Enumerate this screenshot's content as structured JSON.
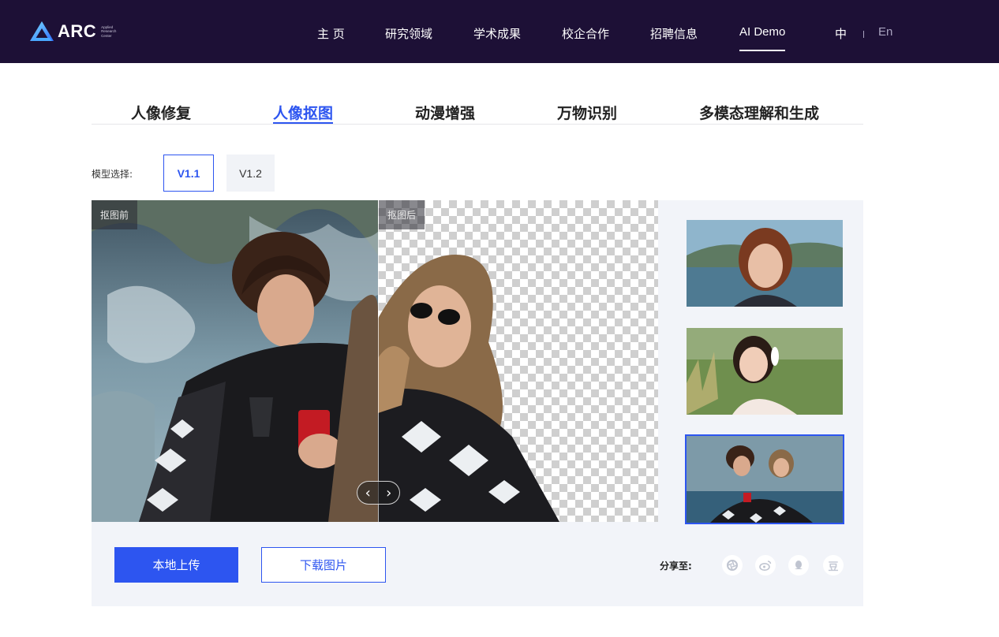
{
  "brand": {
    "logo_text": "ARC",
    "logo_sub": [
      "Applied",
      "Research",
      "Center"
    ]
  },
  "nav": {
    "items": [
      "主 页",
      "研究领域",
      "学术成果",
      "校企合作",
      "招聘信息",
      "AI Demo"
    ],
    "active": "AI Demo",
    "lang_zh": "中",
    "lang_en": "En"
  },
  "tabs": {
    "items": [
      "人像修复",
      "人像抠图",
      "动漫增强",
      "万物识别",
      "多模态理解和生成"
    ],
    "active": "人像抠图"
  },
  "model_select": {
    "label": "模型选择:",
    "options": [
      "V1.1",
      "V1.2"
    ],
    "selected": "V1.1"
  },
  "compare": {
    "before_label": "抠图前",
    "after_label": "抠图后",
    "slider_position": 0.506
  },
  "thumbnails": {
    "icons": [
      "portrait-redhead-lake-thumbnail",
      "girl-headphones-grass-thumbnail",
      "two-women-blanket-thumbnail"
    ],
    "selected": 2
  },
  "actions": {
    "upload_label": "本地上传",
    "download_label": "下载图片"
  },
  "share": {
    "label": "分享至:",
    "icons": [
      "wechat-moments-icon",
      "weibo-icon",
      "qq-icon",
      "douban-icon"
    ],
    "douban_glyph": "豆"
  },
  "colors": {
    "nav_bg": "#1d1036",
    "accent": "#2d55f0",
    "panel_bg": "#f2f4f9"
  }
}
